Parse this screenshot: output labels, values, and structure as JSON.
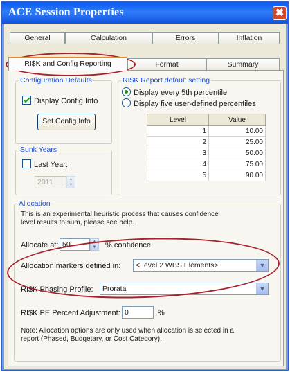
{
  "window": {
    "title": "ACE Session Properties",
    "close_glyph": "✖"
  },
  "tabs_back": [
    "General",
    "Calculation",
    "Errors",
    "Inflation"
  ],
  "tabs_front": [
    "RI$K and Config Reporting",
    "Format",
    "Summary"
  ],
  "active_tab": "RI$K and Config Reporting",
  "config_defaults": {
    "legend": "Configuration Defaults",
    "display_config_label": "Display Config Info",
    "display_config_checked": true,
    "set_config_button": "Set Config Info"
  },
  "risk_report": {
    "legend": "RI$K Report default setting",
    "option_every5": "Display every 5th percentile",
    "option_user": "Display five user-defined percentiles",
    "selected": "every5",
    "table_headers": [
      "Level",
      "Value"
    ],
    "rows": [
      {
        "level": "1",
        "value": "10.00"
      },
      {
        "level": "2",
        "value": "25.00"
      },
      {
        "level": "3",
        "value": "50.00"
      },
      {
        "level": "4",
        "value": "75.00"
      },
      {
        "level": "5",
        "value": "90.00"
      }
    ]
  },
  "sunk_years": {
    "legend": "Sunk Years",
    "last_year_label": "Last Year:",
    "last_year_checked": false,
    "year_value": "2011"
  },
  "allocation": {
    "legend": "Allocation",
    "description": "This is an experimental heuristic process that causes confidence level results to sum, please see help.",
    "allocate_at_label": "Allocate at:",
    "allocate_at_value": "50",
    "confidence_label": "% confidence",
    "markers_label": "Allocation markers defined in:",
    "markers_value": "<Level 2 WBS Elements>",
    "phasing_label": "RI$K Phasing Profile:",
    "phasing_value": "Prorata",
    "pe_label": "RI$K PE Percent Adjustment:",
    "pe_value": "0",
    "pe_unit": "%",
    "note": "Note: Allocation options are only used when allocation is selected in a report (Phased, Budgetary, or Cost Category)."
  },
  "colors": {
    "titlebar": "#0a58f0",
    "legend": "#1f4fd6",
    "highlight_oval": "#a7222d"
  }
}
